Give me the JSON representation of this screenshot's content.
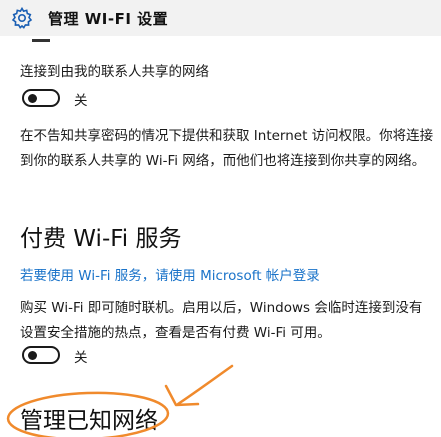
{
  "header": {
    "title": "管理 WI-FI 设置",
    "icon": "gear-icon"
  },
  "contacts_share": {
    "label": "连接到由我的联系人共享的网络",
    "toggle_state": "关",
    "description": "在不告知共享密码的情况下提供和获取 Internet 访问权限。你将连接到你的联系人共享的 Wi-Fi 网络，而他们也将连接到你共享的网络。"
  },
  "paid_wifi": {
    "section_title": "付费 Wi-Fi 服务",
    "login_link": "若要使用 Wi-Fi 服务，请使用 Microsoft 帐户登录",
    "description": "购买 Wi-Fi 即可随时联机。启用以后，Windows 会临时连接到没有设置安全措施的热点，查看是否有付费 Wi-Fi 可用。",
    "toggle_state": "关"
  },
  "known_networks": {
    "section_title": "管理已知网络"
  },
  "annotation": {
    "color": "#f08a2c"
  }
}
